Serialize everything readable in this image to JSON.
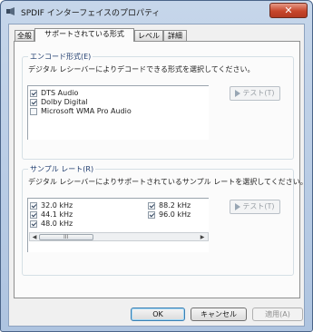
{
  "window": {
    "title": "SPDIF インターフェイスのプロパティ",
    "close_label": "✕"
  },
  "tabs": [
    {
      "label": "全般"
    },
    {
      "label": "サポートされている形式"
    },
    {
      "label": "レベル"
    },
    {
      "label": "詳細"
    }
  ],
  "encode": {
    "title": "エンコード形式(E)",
    "description": "デジタル レシーバーによりデコードできる形式を選択してください。",
    "items": [
      {
        "label": "DTS Audio",
        "checked": true
      },
      {
        "label": "Dolby Digital",
        "checked": true
      },
      {
        "label": "Microsoft WMA Pro Audio",
        "checked": false
      }
    ],
    "test_label": "テスト(T)"
  },
  "sample_rate": {
    "title": "サンプル レート(R)",
    "description": "デジタル レシーバーによりサポートされているサンプル レートを選択してください。",
    "items": [
      {
        "label": "32.0 kHz",
        "checked": true
      },
      {
        "label": "44.1 kHz",
        "checked": true
      },
      {
        "label": "48.0 kHz",
        "checked": true
      },
      {
        "label": "88.2 kHz",
        "checked": true
      },
      {
        "label": "96.0 kHz",
        "checked": true
      }
    ],
    "test_label": "テスト(T)",
    "scroll_grip": "III"
  },
  "buttons": {
    "ok": "OK",
    "cancel": "キャンセル",
    "apply": "適用(A)"
  }
}
